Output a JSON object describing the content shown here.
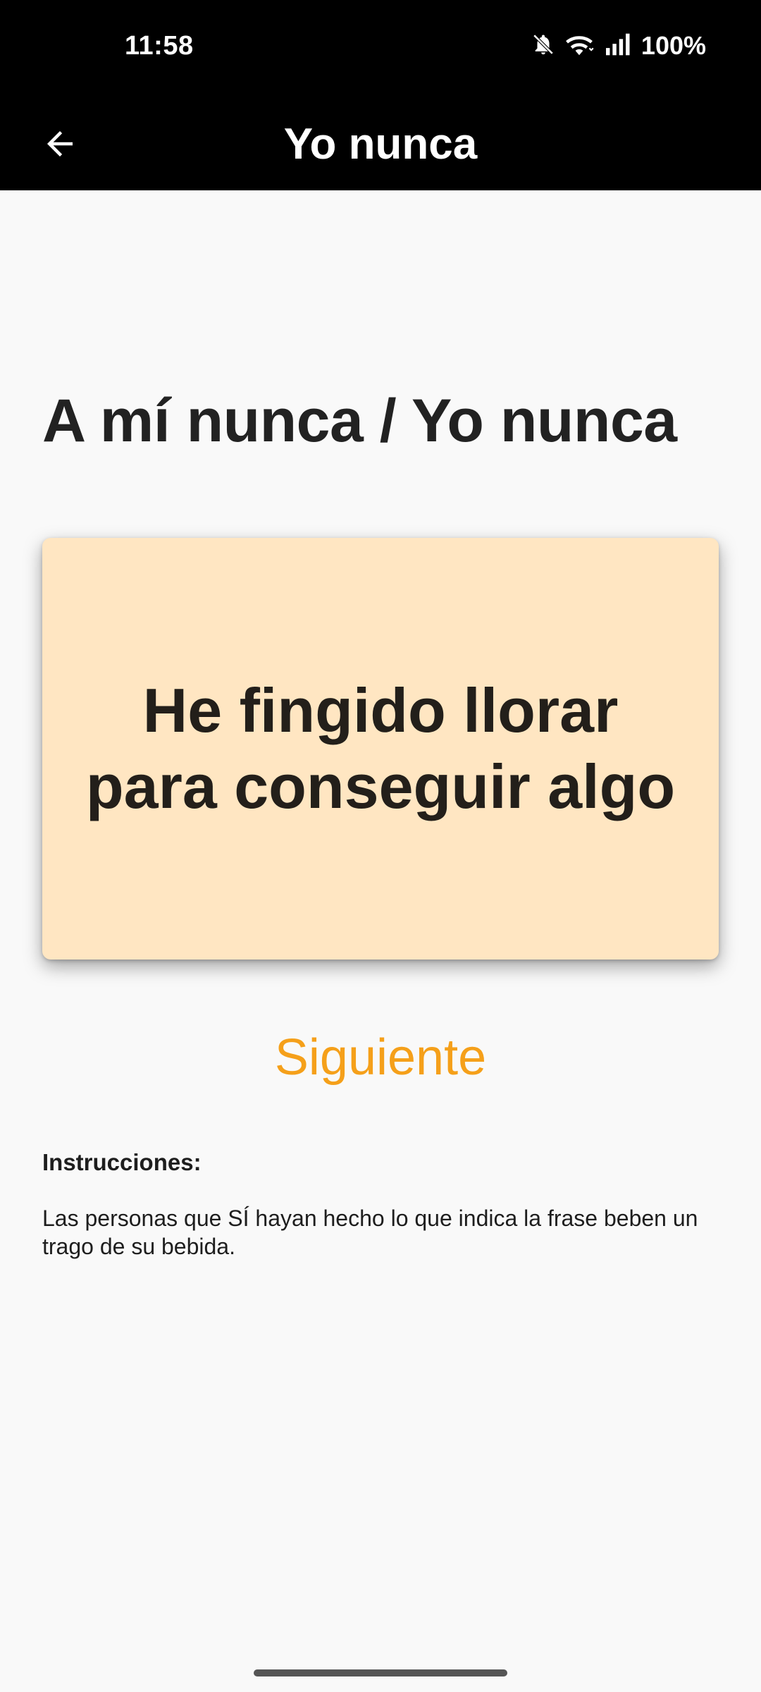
{
  "status_bar": {
    "time": "11:58",
    "battery": "100%",
    "icons": [
      "bell-off-icon",
      "wifi-icon",
      "signal-icon"
    ]
  },
  "app_bar": {
    "title": "Yo nunca",
    "back_icon": "arrow-back-icon"
  },
  "main": {
    "heading": "A mí nunca / Yo nunca",
    "card_text": "He fingido llorar para conseguir algo",
    "next_label": "Siguiente",
    "instructions_title": "Instrucciones:",
    "instructions_body": "Las personas que SÍ hayan hecho lo que indica la frase beben un trago de su bebida."
  },
  "colors": {
    "bar_background": "#000000",
    "page_background": "#f9f9f9",
    "card_background": "#ffe6c2",
    "accent": "#f5a01a"
  }
}
